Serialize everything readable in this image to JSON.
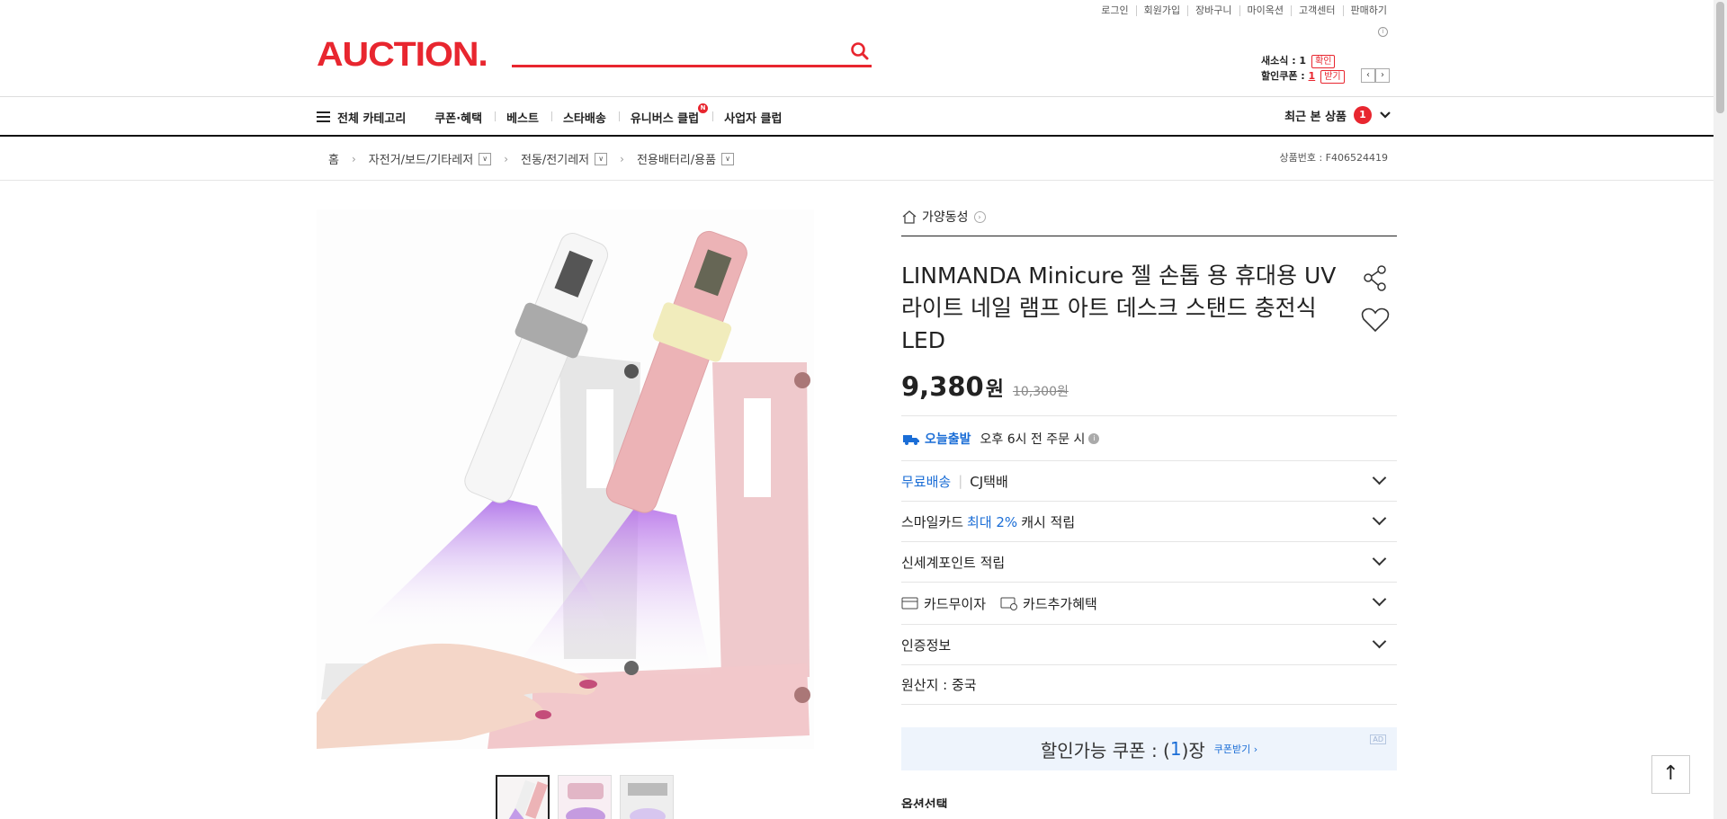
{
  "util": [
    "로그인",
    "회원가입",
    "장바구니",
    "마이옥션",
    "고객센터",
    "판매하기"
  ],
  "logo": "AUCTION.",
  "search": {
    "placeholder": ""
  },
  "mini": {
    "news_label": "새소식 : 1",
    "news_btn": "확인",
    "coupon_label": "할인쿠폰 : ",
    "coupon_count": "1",
    "coupon_btn": "받기"
  },
  "gnb": {
    "all": "전체 카테고리",
    "items": [
      "쿠폰·혜택",
      "베스트",
      "스타배송",
      "유니버스 클럽",
      "사업자 클럽"
    ],
    "new": "N",
    "recent": "최근 본 상품",
    "recent_count": "1"
  },
  "crumb": {
    "home": "홈",
    "c1": "자전거/보드/기타레저",
    "c2": "전동/전기레저",
    "c3": "전용배터리/용품"
  },
  "product_no": "상품번호 : F406524419",
  "store": "가양동성",
  "title": "LINMANDA Minicure 젤 손톱 용 휴대용 UV 라이트 네일 램프 아트 데스크 스탠드 충전식 LED",
  "price": {
    "sale": "9,380",
    "unit": "원",
    "original": "10,300원"
  },
  "delivery": {
    "today": "오늘출발",
    "today_desc": "오후 6시 전 주문 시"
  },
  "rows": {
    "free": "무료배송",
    "carrier": "CJ택배",
    "smile_a": "스마일카드 ",
    "smile_b": "최대 2%",
    "smile_c": " 캐시 적립",
    "shinsegae": "신세계포인트 적립",
    "card_free": "카드무이자",
    "card_extra": "카드추가혜택",
    "cert": "인증정보",
    "origin": "원산지 : 중국"
  },
  "coupon": {
    "a": "할인가능 쿠폰 : (",
    "n": "1",
    "b": ")장",
    "btn": "쿠폰받기 ›",
    "ad": "AD"
  },
  "option_title": "옵션선택",
  "colors": {
    "brand": "#e8262f",
    "blue": "#1a6dd6",
    "coupon_bg": "#eef4fc"
  }
}
